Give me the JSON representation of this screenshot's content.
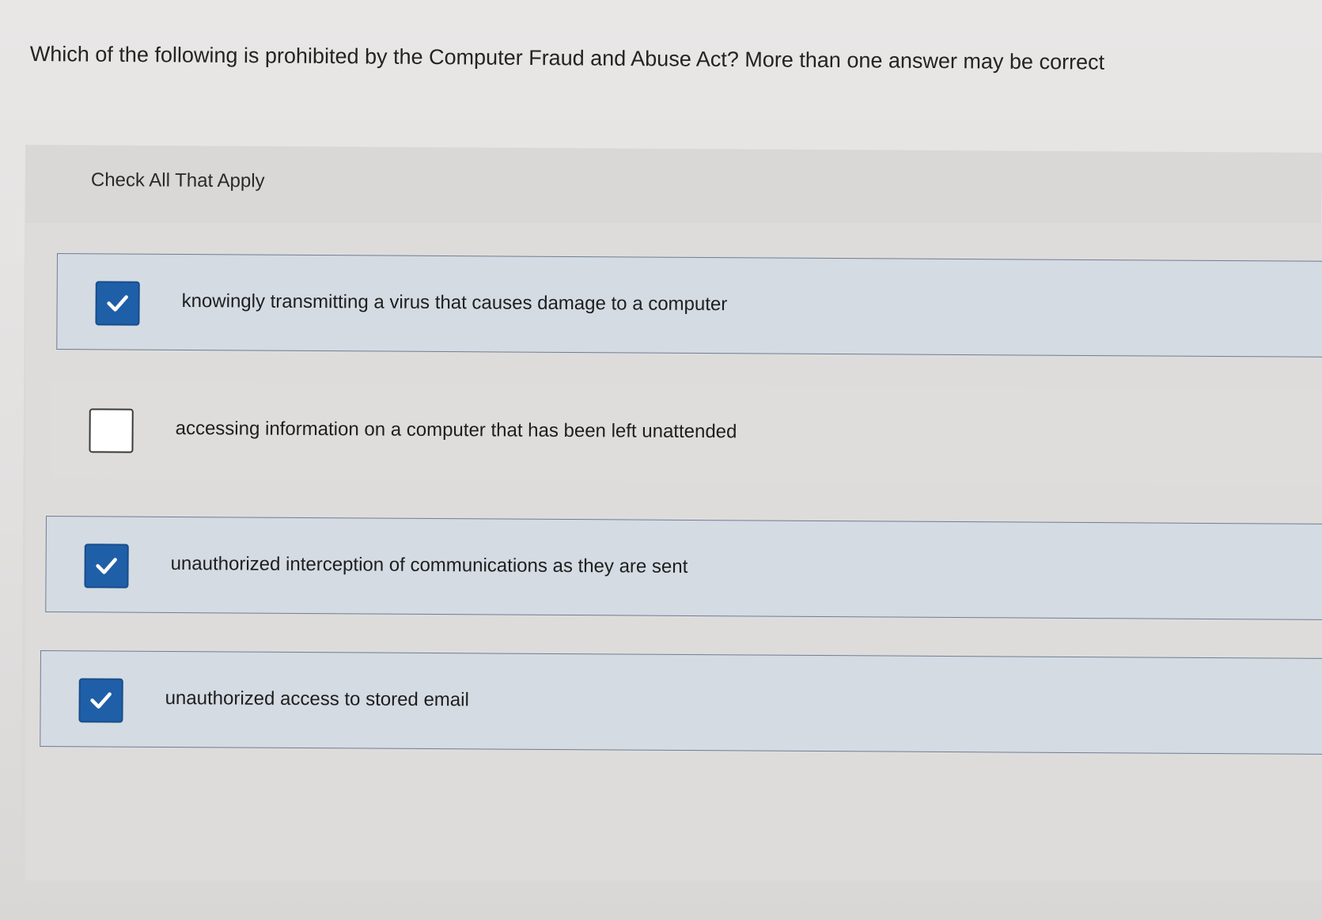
{
  "question": {
    "text": "Which of the following is prohibited by the Computer Fraud and Abuse Act? More than one answer may be correct"
  },
  "instruction": "Check All That Apply",
  "options": [
    {
      "label": "knowingly transmitting a virus that causes damage to a computer",
      "checked": true
    },
    {
      "label": "accessing information on a computer that has been left unattended",
      "checked": false
    },
    {
      "label": "unauthorized interception of communications as they are sent",
      "checked": true
    },
    {
      "label": "unauthorized access to stored email",
      "checked": true
    }
  ],
  "colors": {
    "checkbox_checked": "#1f5fa8",
    "selected_option_bg": "#d4dbe3",
    "selected_option_border": "#6f7f93"
  },
  "icons": {
    "checked": "checkmark-icon"
  }
}
